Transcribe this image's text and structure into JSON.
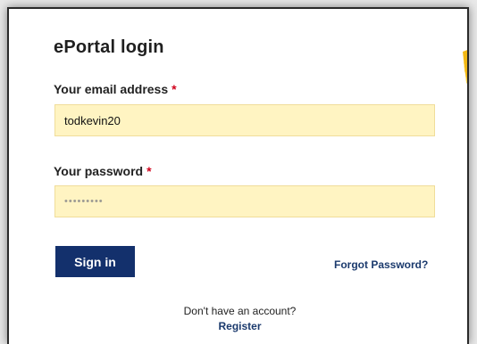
{
  "login": {
    "title": "ePortal login",
    "email_label": "Your email address",
    "email_required": "*",
    "email_value": "todkevin20",
    "password_label": "Your password",
    "password_required": "*",
    "password_value": "•••••••••",
    "signin_label": "Sign in",
    "forgot_label": "Forgot Password?",
    "no_account_text": "Don't have an account?",
    "register_label": "Register"
  },
  "colors": {
    "field_bg": "#fff4c2",
    "button_bg": "#13306c",
    "link": "#1b3a6d",
    "required": "#d0021b"
  }
}
